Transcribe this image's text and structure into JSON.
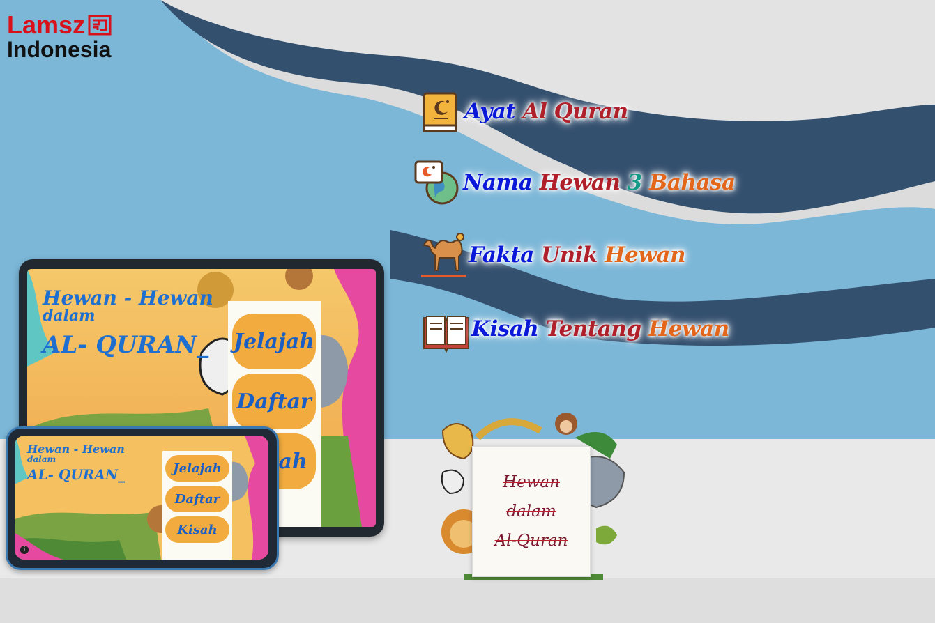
{
  "brand": {
    "line1": "Lamsz",
    "line2": "Indonesia",
    "mark_color": "#d8121b"
  },
  "features": [
    {
      "icon": "quran-book-icon",
      "words": [
        {
          "t": "Ayat",
          "c": "blue"
        },
        {
          "t": "Al",
          "c": "red"
        },
        {
          "t": "Quran",
          "c": "red"
        }
      ]
    },
    {
      "icon": "globe-chat-icon",
      "words": [
        {
          "t": "Nama",
          "c": "blue"
        },
        {
          "t": "Hewan",
          "c": "red"
        },
        {
          "t": "3",
          "c": "teal"
        },
        {
          "t": "Bahasa",
          "c": "orange"
        }
      ]
    },
    {
      "icon": "camel-icon",
      "words": [
        {
          "t": "Fakta",
          "c": "blue"
        },
        {
          "t": "Unik",
          "c": "red"
        },
        {
          "t": "Hewan",
          "c": "orange"
        }
      ]
    },
    {
      "icon": "open-book-icon",
      "words": [
        {
          "t": "Kisah",
          "c": "blue"
        },
        {
          "t": "Tentang",
          "c": "red"
        },
        {
          "t": "Hewan",
          "c": "orange"
        }
      ]
    }
  ],
  "tablet": {
    "title_line1": "Hewan - Hewan",
    "title_line2": "dalam",
    "title_line3": "AL- QURAN_",
    "buttons": [
      "Jelajah",
      "Daftar",
      "Kisah"
    ]
  },
  "phone": {
    "title_line1": "Hewan - Hewan",
    "title_line2": "dalam",
    "title_line3": "AL- QURAN_",
    "buttons": [
      "Jelajah",
      "Daftar",
      "Kisah"
    ]
  },
  "poster": {
    "line1": "Hewan",
    "line2": "dalam",
    "line3": "Al-Quran"
  },
  "colors": {
    "wave_dark": "#34506f",
    "wave_light": "#7cb7d8",
    "button": "#f2ab3e",
    "title_blue": "#1f6fd0"
  }
}
